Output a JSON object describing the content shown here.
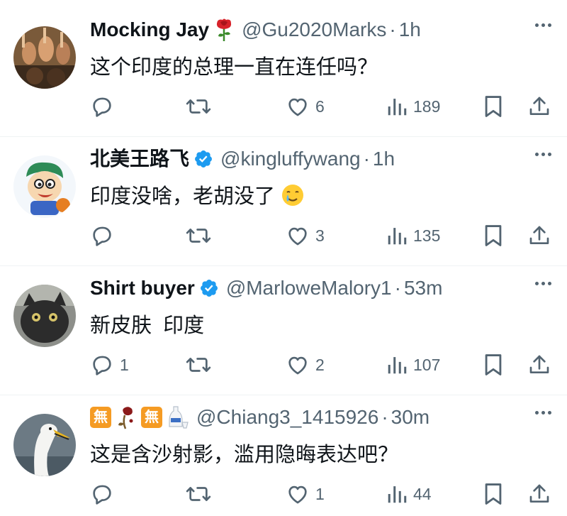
{
  "tweets": [
    {
      "display_name": "Mocking Jay",
      "handle": "@Gu2020Marks",
      "time": "1h",
      "text": "这个印度的总理一直在连任吗？",
      "reply_count": "",
      "retweet_count": "",
      "like_count": "6",
      "view_count": "189"
    },
    {
      "display_name": "北美王路飞",
      "handle": "@kingluffywang",
      "time": "1h",
      "text": "印度没啥，老胡没了",
      "reply_count": "",
      "retweet_count": "",
      "like_count": "3",
      "view_count": "135"
    },
    {
      "display_name": "Shirt buyer",
      "handle": "@MarloweMalory1",
      "time": "53m",
      "text": "新皮肤  印度",
      "reply_count": "1",
      "retweet_count": "",
      "like_count": "2",
      "view_count": "107"
    },
    {
      "display_name": "",
      "emoji_name_glyph": "無",
      "handle": "@Chiang3_1415926",
      "time": "30m",
      "text": "这是含沙射影，滥用隐晦表达吧？",
      "reply_count": "",
      "retweet_count": "",
      "like_count": "1",
      "view_count": "44"
    }
  ],
  "separator": "·",
  "colors": {
    "text": "#0f1419",
    "secondary": "#536471",
    "verified": "#1d9bf0",
    "divider": "#eff3f4"
  },
  "icons": [
    "reply-icon",
    "retweet-icon",
    "like-icon",
    "views-icon",
    "bookmark-icon",
    "share-icon",
    "more-icon",
    "verified-badge-icon",
    "rose-emoji-icon",
    "crying-smile-emoji-icon"
  ]
}
